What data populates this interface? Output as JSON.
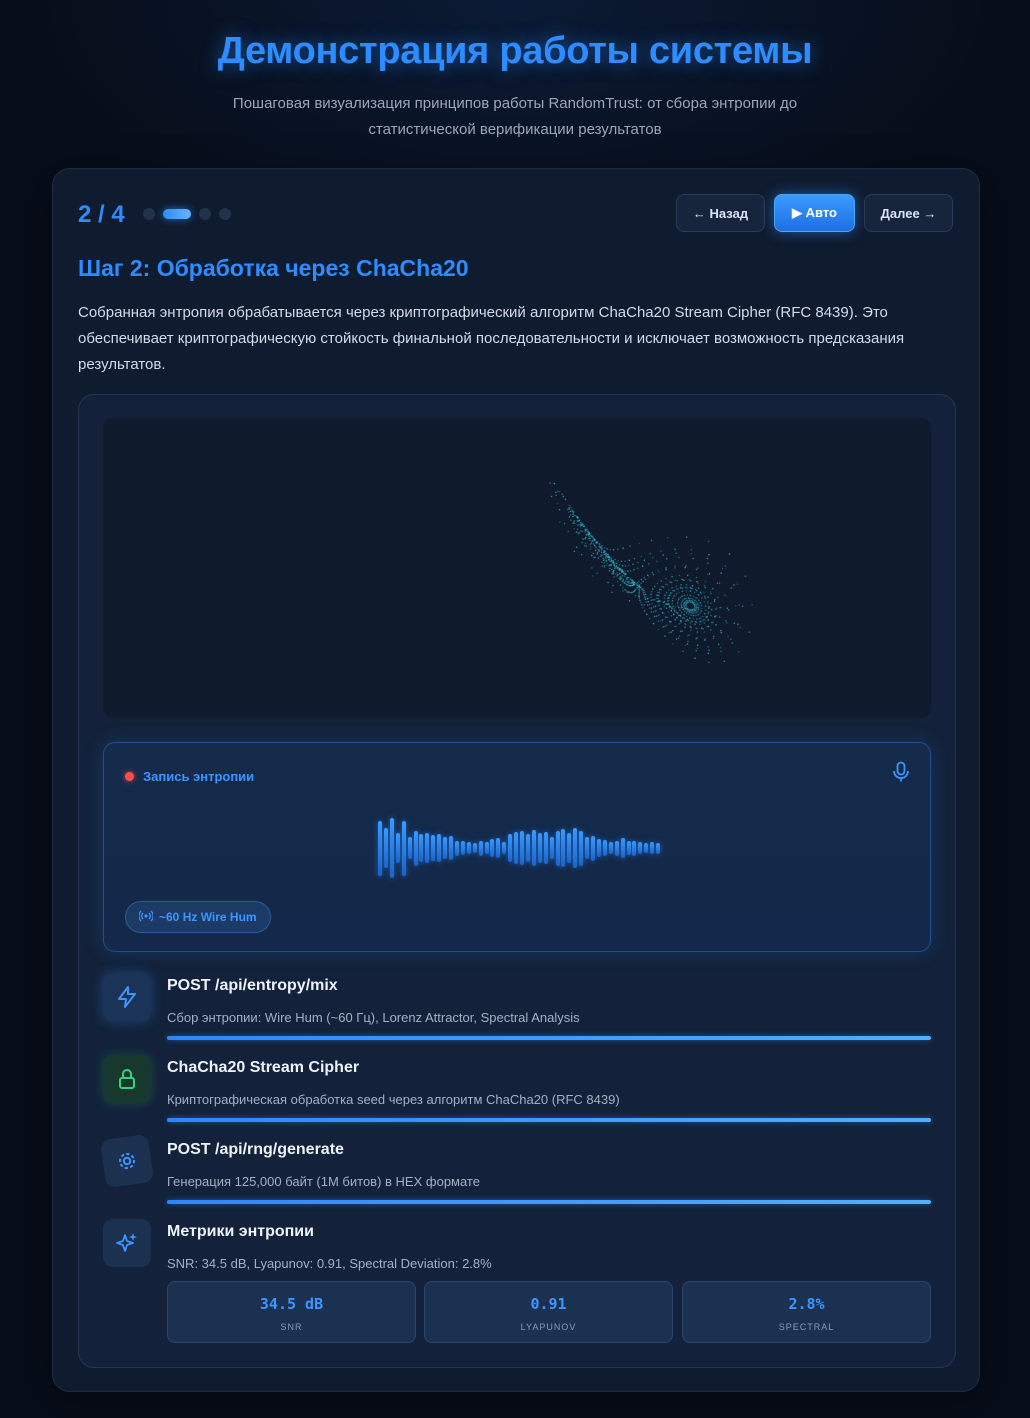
{
  "header": {
    "title": "Демонстрация работы системы",
    "subtitle": "Пошаговая визуализация принципов работы RandomTrust: от сбора энтропии до статистической верификации результатов"
  },
  "stepper": {
    "counter": "2 / 4",
    "current_step": 2,
    "total_steps": 4,
    "prev_label": "← Назад",
    "auto_label": "▶ Авто",
    "next_label": "Далее →"
  },
  "step": {
    "title": "Шаг 2: Обработка через ChaCha20",
    "description": "Собранная энтропия обрабатывается через криптографический алгоритм ChaCha20 Stream Cipher (RFC 8439). Это обеспечивает криптографическую стойкость финальной последовательности и исключает возможность предсказания результатов."
  },
  "recorder": {
    "label": "Запись энтропии",
    "badge": "~60 Hz Wire Hum",
    "waveform_levels": [
      0.55,
      0.4,
      0.6,
      0.3,
      0.55,
      0.22,
      0.35,
      0.28,
      0.3,
      0.26,
      0.28,
      0.22,
      0.24,
      0.15,
      0.14,
      0.12,
      0.1,
      0.15,
      0.12,
      0.18,
      0.2,
      0.12,
      0.28,
      0.32,
      0.34,
      0.28,
      0.36,
      0.3,
      0.32,
      0.22,
      0.35,
      0.38,
      0.3,
      0.4,
      0.35,
      0.22,
      0.25,
      0.18,
      0.16,
      0.12,
      0.15,
      0.2,
      0.14,
      0.15,
      0.12,
      0.1,
      0.12,
      0.11
    ],
    "accent_color": "#2d8cff"
  },
  "pipeline": [
    {
      "icon": "lightning-icon",
      "title": "POST /api/entropy/mix",
      "subtitle": "Сбор энтропии: Wire Hum (~60 Гц), Lorenz Attractor, Spectral Analysis",
      "progress": 1.0
    },
    {
      "icon": "lock-icon",
      "title": "ChaCha20 Stream Cipher",
      "subtitle": "Криптографическая обработка seed через алгоритм ChaCha20 (RFC 8439)",
      "progress": 1.0
    },
    {
      "icon": "gear-icon",
      "title": "POST /api/rng/generate",
      "subtitle": "Генерация 125,000 байт (1M битов) в HEX формате",
      "progress": 1.0
    },
    {
      "icon": "sparkles-icon",
      "title": "Метрики энтропии",
      "subtitle": "SNR: 34.5 dB, Lyapunov: 0.91, Spectral Deviation: 2.8%"
    }
  ],
  "metrics": [
    {
      "value": "34.5 dB",
      "label": "SNR"
    },
    {
      "value": "0.91",
      "label": "LYAPUNOV"
    },
    {
      "value": "2.8%",
      "label": "SPECTRAL"
    }
  ]
}
